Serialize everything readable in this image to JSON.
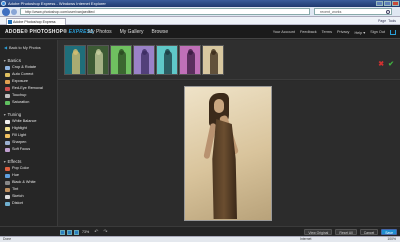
{
  "browser": {
    "title": "Adobe Photoshop Express - Windows Internet Explorer",
    "address": "http://www.photoshop.com/user/vanjaedited",
    "search_value": "recent_works",
    "tab_label": "Adobe Photoshop Express",
    "fav_tools": [
      "Page",
      "Tools"
    ],
    "status_left": "Done",
    "status_zone": "Internet",
    "status_zoom": "100%"
  },
  "app": {
    "logo_main": "ADOBE® PHOTOSHOP®",
    "logo_sub": "EXPRESS",
    "beta": "beta",
    "nav": [
      "My Photos",
      "My Gallery",
      "Browse"
    ],
    "right_nav": [
      "Your Account",
      "Feedback",
      "Terms",
      "Privacy",
      "Help ▾",
      "Sign Out"
    ]
  },
  "sidebar": {
    "back_label": "Back to My Photos",
    "sections": [
      {
        "title": "Basics",
        "items": [
          {
            "label": "Crop & Rotate",
            "color": "#8fb4e0"
          },
          {
            "label": "Auto Correct",
            "color": "#e0c060"
          },
          {
            "label": "Exposure",
            "color": "#e0a050"
          },
          {
            "label": "Red-Eye Removal",
            "color": "#d05050"
          },
          {
            "label": "Touchup",
            "color": "#c0c0c0"
          },
          {
            "label": "Saturation",
            "color": "#60c060"
          }
        ]
      },
      {
        "title": "Tuning",
        "items": [
          {
            "label": "White Balance",
            "color": "#eeeeee"
          },
          {
            "label": "Highlight",
            "color": "#f0e090"
          },
          {
            "label": "Fill Light",
            "color": "#f0c060"
          },
          {
            "label": "Sharpen",
            "color": "#9ab0d0"
          },
          {
            "label": "Soft Focus",
            "color": "#c0a0d0"
          }
        ]
      },
      {
        "title": "Effects",
        "items": [
          {
            "label": "Pop Color",
            "color": "#e06040"
          },
          {
            "label": "Hue",
            "color": "#60a0e0"
          },
          {
            "label": "Black & White",
            "color": "#888888"
          },
          {
            "label": "Tint",
            "color": "#c09060"
          },
          {
            "label": "Sketch",
            "color": "#dddddd"
          },
          {
            "label": "Distort",
            "color": "#70b0d0"
          }
        ]
      }
    ]
  },
  "thumbnails": [
    {
      "bg": "#1f6e7a",
      "fig": "#d8c070"
    },
    {
      "bg": "#3c5a34",
      "fig": "#c8d0a0"
    },
    {
      "bg": "#6fc060",
      "fig": "#2a4a20"
    },
    {
      "bg": "#9a82c8",
      "fig": "#3a2a60"
    },
    {
      "bg": "#5fc8c8",
      "fig": "#1a3a40"
    },
    {
      "bg": "#c070b8",
      "fig": "#3a1a40"
    },
    {
      "bg": "#d8c8a0",
      "fig": "#3a2a1a"
    }
  ],
  "markers": {
    "reject": "✖",
    "accept": "✔",
    "reject_color": "#d03030",
    "accept_color": "#40b040"
  },
  "bottom": {
    "zoom": "73%",
    "buttons": [
      "View Original",
      "Reset All",
      "Cancel",
      "Save"
    ]
  }
}
